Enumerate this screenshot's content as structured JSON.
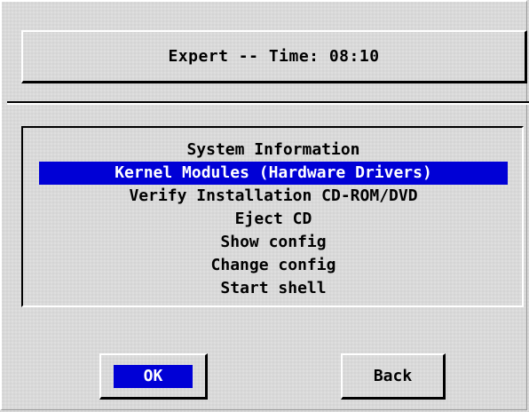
{
  "header": {
    "title": "Expert -- Time: 08:10"
  },
  "menu": {
    "selected_index": 1,
    "items": [
      {
        "label": "System Information"
      },
      {
        "label": "Kernel Modules (Hardware Drivers)"
      },
      {
        "label": "Verify Installation CD-ROM/DVD"
      },
      {
        "label": "Eject CD"
      },
      {
        "label": "Show config"
      },
      {
        "label": "Change config"
      },
      {
        "label": "Start shell"
      }
    ]
  },
  "buttons": {
    "ok_label": "OK",
    "back_label": "Back",
    "focused": "ok"
  },
  "colors": {
    "background": "#d9d9d9",
    "highlight": "#0000d6",
    "highlight_text": "#ffffff"
  }
}
